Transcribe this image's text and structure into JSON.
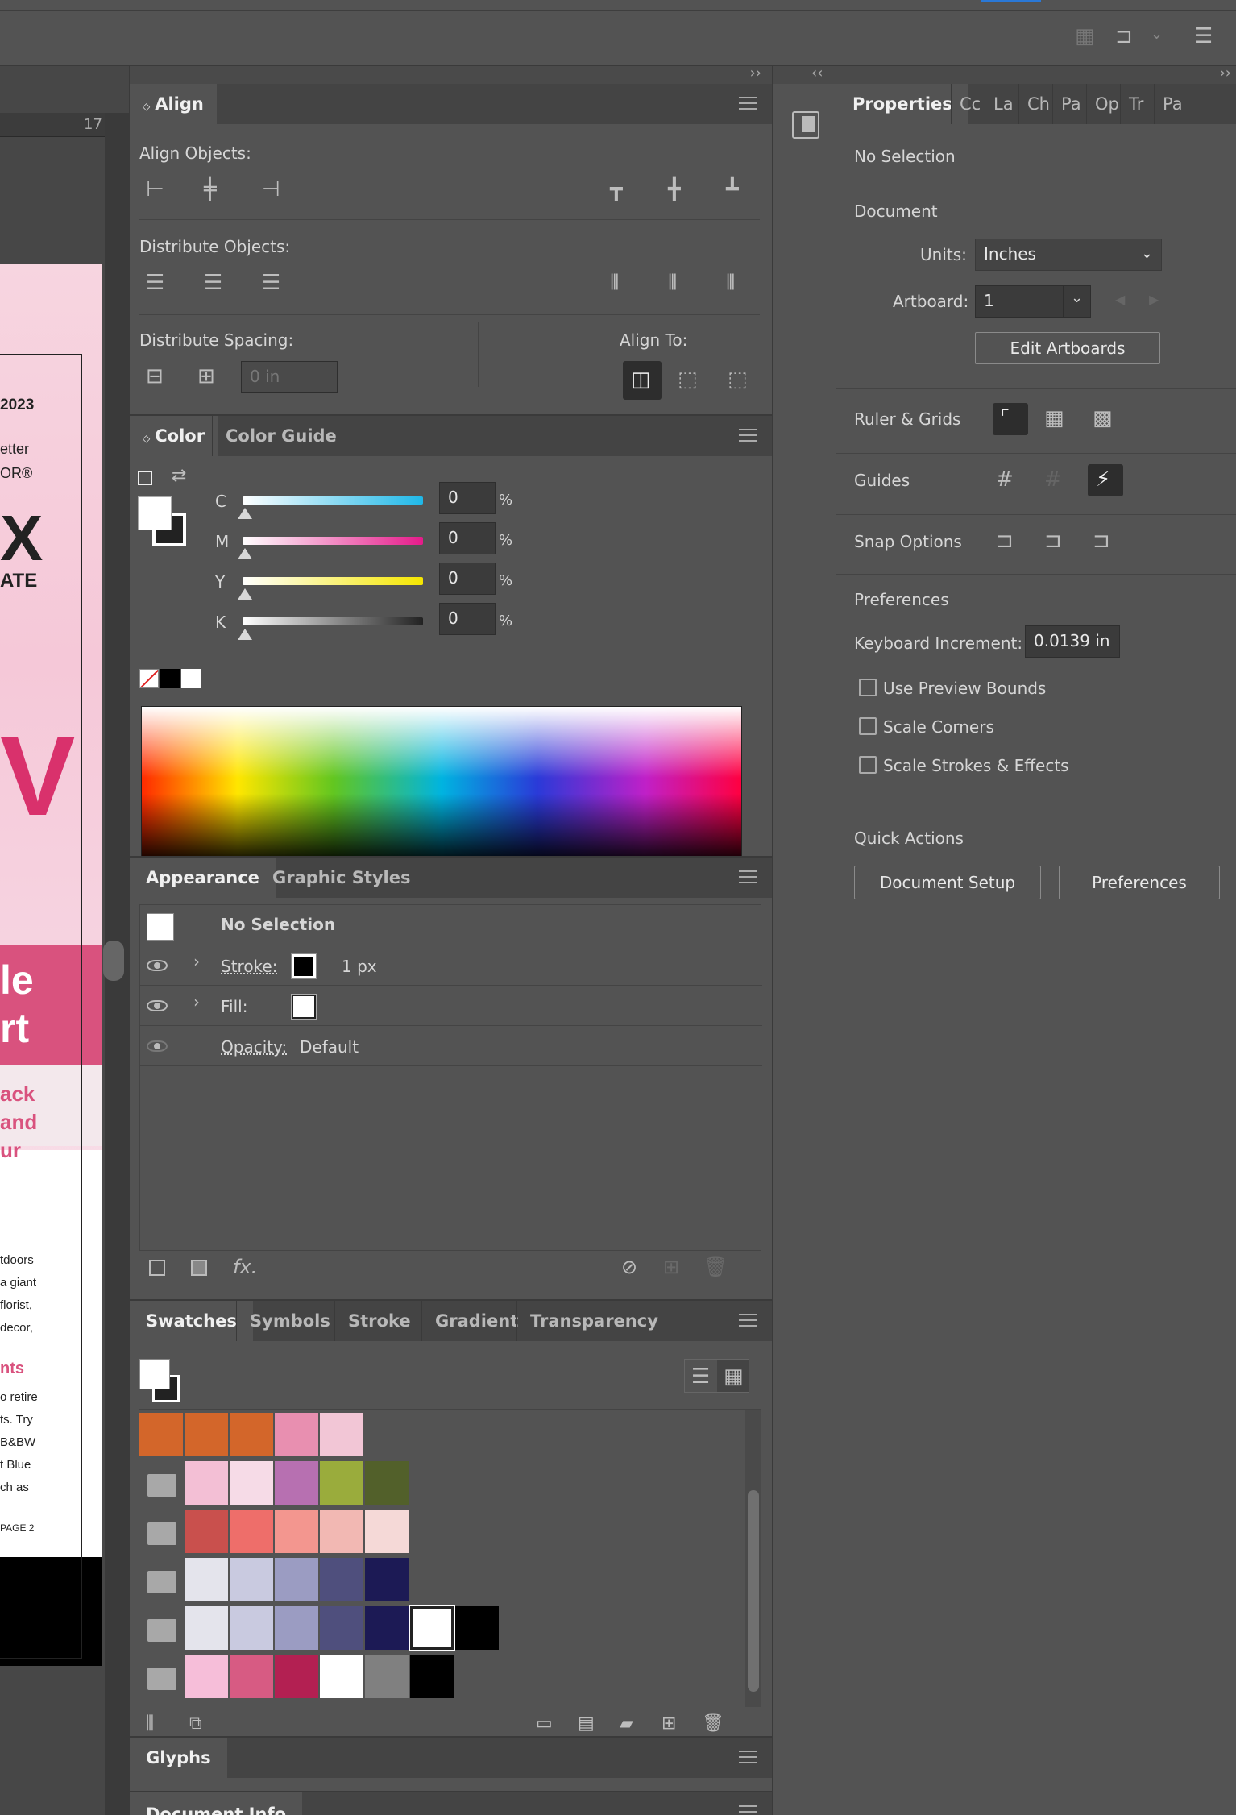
{
  "colors": {
    "panel_bg": "#535353",
    "header_bg": "#444444",
    "accent": "#d96a2a",
    "pink": "#e07aa0"
  },
  "canvas": {
    "ruler_tick": "17",
    "doc_lines": [
      "2023",
      "etter",
      "OR®",
      "X",
      "ATE",
      "V",
      "le",
      "rt",
      "ack",
      "and",
      "ur",
      "tdoors",
      "a giant",
      "florist,",
      "decor,",
      "nts",
      "o retire",
      "ts. Try",
      "B&BW",
      "t Blue",
      "ch as",
      "PAGE 2"
    ]
  },
  "align_panel": {
    "tab": "Align",
    "align_objects_label": "Align Objects:",
    "distribute_objects_label": "Distribute Objects:",
    "distribute_spacing_label": "Distribute Spacing:",
    "align_to_label": "Align To:",
    "spacing_value": "0 in"
  },
  "color_panel": {
    "tab_active": "Color",
    "tab_other": "Color Guide",
    "channels": [
      {
        "name": "C",
        "value": "0",
        "unit": "%",
        "gradient": "linear-gradient(90deg,#fff,#1fb8e8)"
      },
      {
        "name": "M",
        "value": "0",
        "unit": "%",
        "gradient": "linear-gradient(90deg,#fff,#e51b8a)"
      },
      {
        "name": "Y",
        "value": "0",
        "unit": "%",
        "gradient": "linear-gradient(90deg,#fff,#f5e600)"
      },
      {
        "name": "K",
        "value": "0",
        "unit": "%",
        "gradient": "linear-gradient(90deg,#fff,#222)"
      }
    ]
  },
  "appearance_panel": {
    "tab_active": "Appearance",
    "tab_other": "Graphic Styles",
    "header": "No Selection",
    "stroke_label": "Stroke:",
    "stroke_value": "1 px",
    "fill_label": "Fill:",
    "opacity_label": "Opacity:",
    "opacity_value": "Default"
  },
  "swatches_panel": {
    "tabs": [
      "Swatches",
      "Symbols",
      "Stroke",
      "Gradient",
      "Transparency"
    ],
    "rows": [
      {
        "folder": false,
        "colors": [
          "#d3662a",
          "#d3662a",
          "#d3662a",
          "#e88fb0",
          "#f2c6d6"
        ]
      },
      {
        "folder": true,
        "colors": [
          "#f3bfd5",
          "#f6dbe7",
          "#b770b1",
          "#9aac3c",
          "#52602a"
        ]
      },
      {
        "folder": true,
        "colors": [
          "#c9504d",
          "#ee6e6a",
          "#f3968f",
          "#f2b8b3",
          "#f5d9d7"
        ]
      },
      {
        "folder": true,
        "colors": [
          "#e4e4ec",
          "#c9cae0",
          "#9b9cc2",
          "#4f4f7d",
          "#1c1a55"
        ]
      },
      {
        "folder": true,
        "colors": [
          "#e4e4ec",
          "#c9cae0",
          "#9b9cc2",
          "#4f4f7d",
          "#1c1a55",
          "#ffffff",
          "#000000"
        ]
      },
      {
        "folder": true,
        "colors": [
          "#f6bed9",
          "#d75b83",
          "#b32052",
          "#ffffff",
          "#808080",
          "#000000"
        ]
      }
    ]
  },
  "glyphs_panel": {
    "tab": "Glyphs"
  },
  "docinfo_panel": {
    "tab": "Document Info"
  },
  "properties_panel": {
    "tab_active": "Properties",
    "tabs_other": [
      "Cc",
      "La",
      "Ch",
      "Pa",
      "Op",
      "Tr",
      "Pa"
    ],
    "no_selection": "No Selection",
    "document_label": "Document",
    "units_label": "Units:",
    "units_value": "Inches",
    "artboard_label": "Artboard:",
    "artboard_value": "1",
    "edit_artboards": "Edit Artboards",
    "ruler_grids": "Ruler & Grids",
    "guides": "Guides",
    "snap_options": "Snap Options",
    "preferences_label": "Preferences",
    "keyboard_increment_label": "Keyboard Increment:",
    "keyboard_increment_value": "0.0139 in",
    "use_preview_bounds": "Use Preview Bounds",
    "scale_corners": "Scale Corners",
    "scale_strokes": "Scale Strokes & Effects",
    "quick_actions": "Quick Actions",
    "document_setup": "Document Setup",
    "preferences_button": "Preferences"
  }
}
